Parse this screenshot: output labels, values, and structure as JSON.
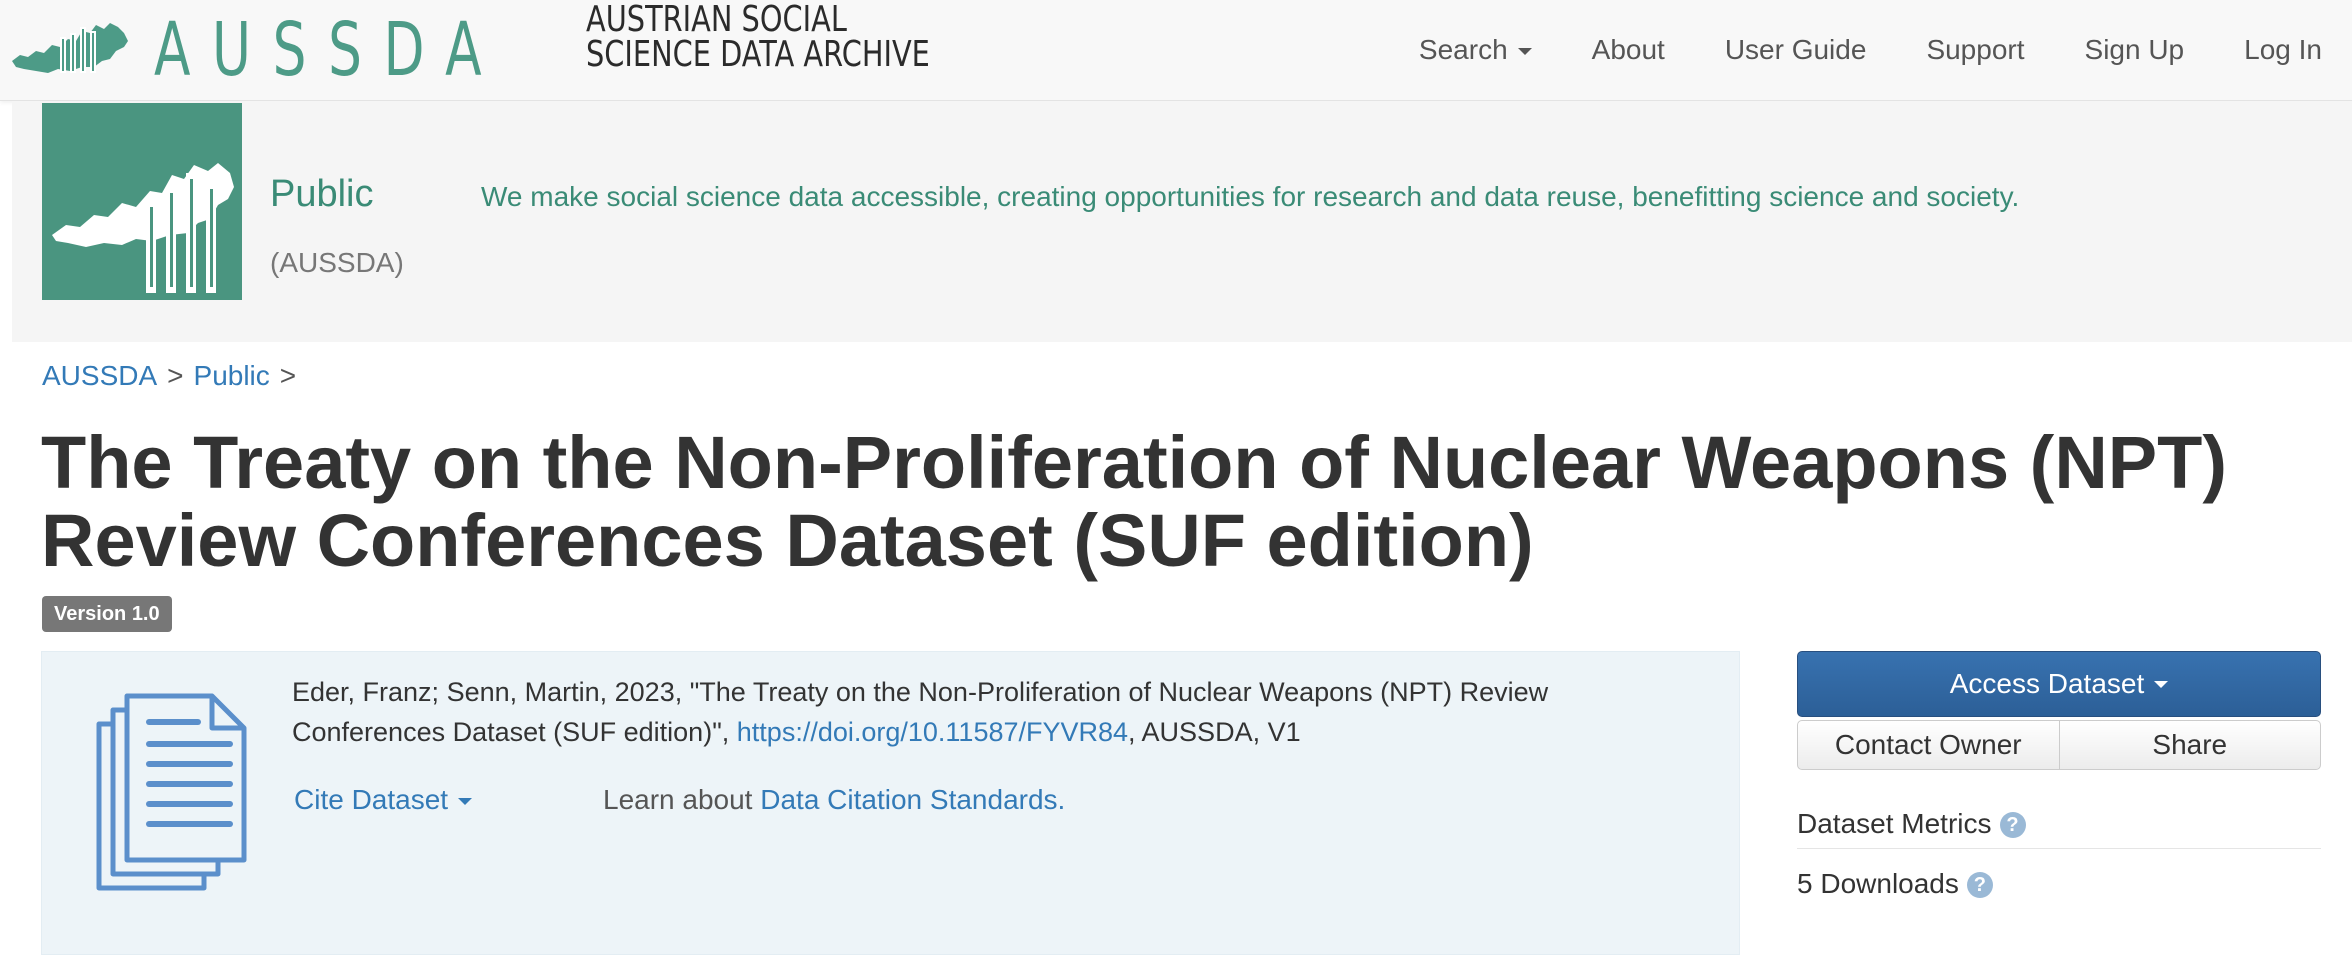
{
  "navbar": {
    "logo_word": "AUSSDA",
    "logo_subtitle_line1": "AUSTRIAN SOCIAL",
    "logo_subtitle_line2": "SCIENCE DATA ARCHIVE",
    "links": {
      "search": "Search",
      "about": "About",
      "user_guide": "User Guide",
      "support": "Support",
      "sign_up": "Sign Up",
      "log_in": "Log In"
    }
  },
  "dataverse": {
    "name": "Public",
    "affiliation": "(AUSSDA)",
    "tagline": "We make social science data accessible, creating opportunities for research and data reuse, benefitting science and society."
  },
  "breadcrumb": {
    "items": [
      "AUSSDA",
      "Public"
    ],
    "separator": ">"
  },
  "dataset": {
    "title_line1": "The Treaty on the Non-Proliferation of Nuclear Weapons (NPT)",
    "title_line2": "Review Conferences Dataset (SUF edition)",
    "version": "Version 1.0",
    "citation_text": "Eder, Franz; Senn, Martin, 2023, \"The Treaty on the Non-Proliferation of Nuclear Weapons (NPT) Review Conferences Dataset (SUF edition)\", ",
    "citation_doi": "https://doi.org/10.11587/FYVR84",
    "citation_tail": ", AUSSDA, V1",
    "cite_button": "Cite Dataset",
    "learn_prefix": "Learn about ",
    "learn_link": "Data Citation Standards."
  },
  "actions": {
    "access_dataset": "Access Dataset",
    "contact_owner": "Contact Owner",
    "share": "Share"
  },
  "metrics": {
    "label": "Dataset Metrics",
    "downloads": "5 Downloads",
    "help_glyph": "?"
  },
  "colors": {
    "brand_green": "#4d9b87",
    "link_blue": "#337ab7",
    "primary_button": "#2c5f97",
    "citation_bg": "#edf4f8"
  }
}
